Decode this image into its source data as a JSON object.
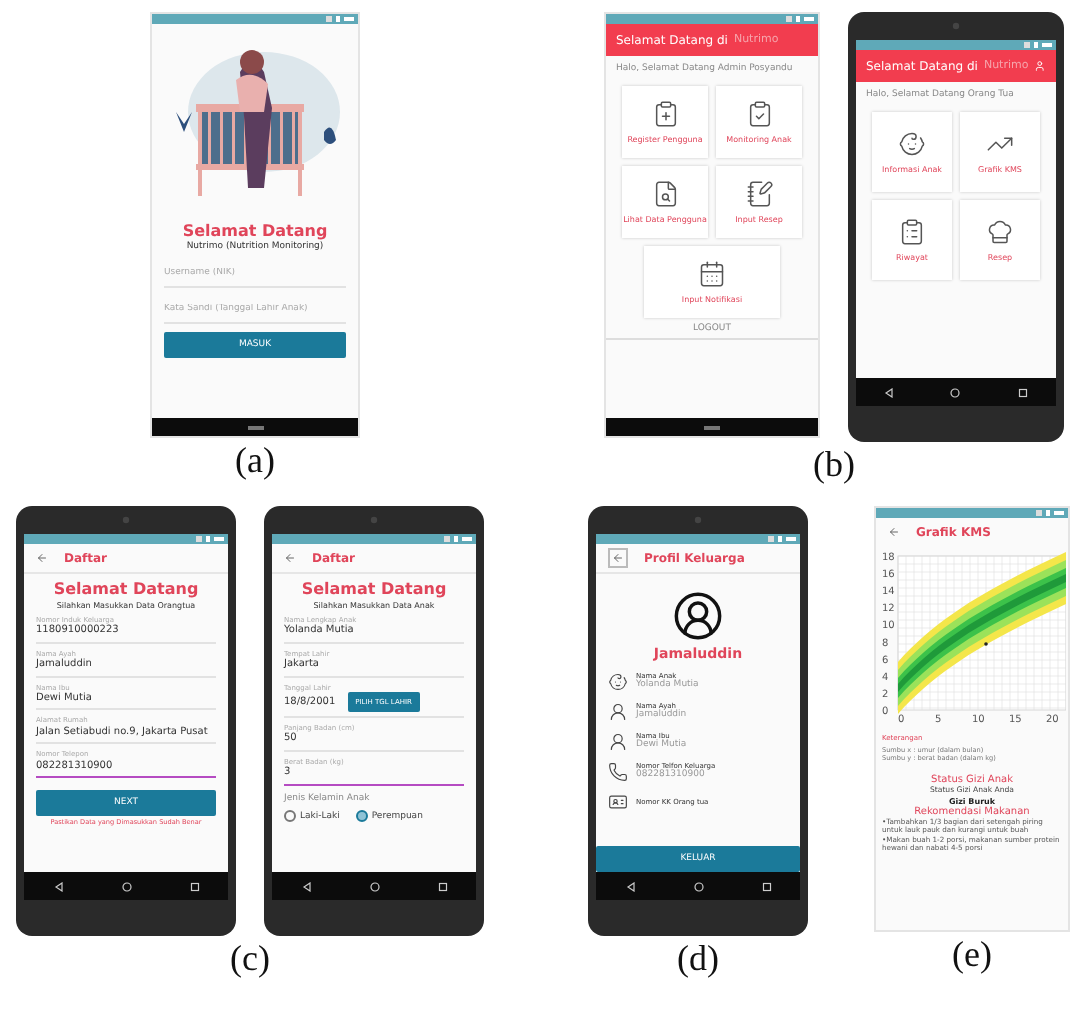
{
  "rows": [
    {
      "panels": [
        {
          "caption": "(a)",
          "screens": [
            {
              "kind": "login",
              "device": false,
              "nav_bar": true,
              "title": "Selamat Datang",
              "subtitle": "Nutrimo (Nutrition Monitoring)",
              "fields": [
                {
                  "placeholder": "Username (NIK)"
                },
                {
                  "placeholder": "Kata Sandi (Tanggal Lahir Anak)"
                }
              ],
              "button": "MASUK"
            }
          ]
        },
        {
          "caption": "(b)",
          "screens": [
            {
              "kind": "menu",
              "device": false,
              "nav_bar": true,
              "header": "Selamat Datang di",
              "brand": "Nutrimo",
              "account_button": false,
              "greeting": "Halo, Selamat Datang Admin Posyandu",
              "items": [
                "Register Pengguna",
                "Monitoring Anak",
                "Lihat Data Pengguna",
                "Input Resep",
                "Input Notifikasi"
              ],
              "footer": "LOGOUT"
            },
            {
              "kind": "menu",
              "device": true,
              "header": "Selamat Datang di",
              "brand": "Nutrimo",
              "account_button": true,
              "greeting": "Halo, Selamat Datang Orang Tua",
              "items": [
                "Informasi Anak",
                "Grafik KMS",
                "Riwayat",
                "Resep"
              ]
            }
          ]
        }
      ]
    },
    {
      "panels": [
        {
          "caption": "(c)",
          "screens": [
            {
              "kind": "form",
              "device": true,
              "header": "Daftar",
              "title": "Selamat Datang",
              "subtitle": "Silahkan Masukkan Data Orangtua",
              "fields": [
                {
                  "kind": "text",
                  "label": "Nomor Induk Keluarga",
                  "value": "1180910000223",
                  "focused": false
                },
                {
                  "kind": "text",
                  "label": "Nama Ayah",
                  "value": "Jamaluddin",
                  "focused": false
                },
                {
                  "kind": "text",
                  "label": "Nama Ibu",
                  "value": "Dewi Mutia",
                  "focused": false
                },
                {
                  "kind": "text",
                  "label": "Alamat Rumah",
                  "value": "Jalan Setiabudi no.9, Jakarta Pusat",
                  "focused": false
                },
                {
                  "kind": "text",
                  "label": "Nomor Telepon",
                  "value": "082281310900",
                  "focused": true
                }
              ],
              "button": "NEXT",
              "note": "Pastikan Data yang Dimasukkan Sudah Benar"
            },
            {
              "kind": "form",
              "device": true,
              "header": "Daftar",
              "title": "Selamat Datang",
              "subtitle": "Silahkan Masukkan Data Anak",
              "fields": [
                {
                  "kind": "text",
                  "label": "Nama Lengkap Anak",
                  "value": "Yolanda Mutia",
                  "focused": false
                },
                {
                  "kind": "text",
                  "label": "Tempat Lahir",
                  "value": "Jakarta",
                  "focused": false
                },
                {
                  "kind": "date",
                  "label": "Tanggal Lahir",
                  "value": "18/8/2001",
                  "button": "PILIH TGL LAHIR",
                  "focused": false
                },
                {
                  "kind": "text",
                  "label": "Panjang Badan (cm)",
                  "value": "50",
                  "focused": false
                },
                {
                  "kind": "text",
                  "label": "Berat Badan (kg)",
                  "value": "3",
                  "focused": true
                }
              ],
              "gender": {
                "label": "Jenis Kelamin Anak",
                "options": [
                  {
                    "label": "Laki-Laki",
                    "selected": false
                  },
                  {
                    "label": "Perempuan",
                    "selected": true
                  }
                ]
              }
            }
          ]
        },
        {
          "caption": "(d)",
          "screens": [
            {
              "kind": "profile",
              "device": true,
              "header": "Profil Keluarga",
              "name": "Jamaluddin",
              "rows": [
                {
                  "label": "Nama Anak",
                  "value": "Yolanda Mutia"
                },
                {
                  "label": "Nama Ayah",
                  "value": "Jamaluddin"
                },
                {
                  "label": "Nama Ibu",
                  "value": "Dewi Mutia"
                },
                {
                  "label": "Nomor Telfon Keluarga",
                  "value": "082281310900"
                },
                {
                  "label": "Nomor KK Orang tua"
                }
              ],
              "button": "KELUAR"
            }
          ]
        },
        {
          "caption": "(e)",
          "screens": [
            {
              "kind": "chart",
              "device": false,
              "nav_bar": false,
              "header": "Grafik KMS",
              "y_ticks": [
                "18",
                "16",
                "14",
                "12",
                "10",
                "8",
                "6",
                "4",
                "2",
                "0"
              ],
              "x_ticks": [
                "0",
                "5",
                "10",
                "15",
                "20"
              ],
              "legend_title": "Keterangan",
              "legend": [
                "Sumbu x : umur (dalam bulan)",
                "Sumbu y : berat badan (dalam kg)"
              ],
              "status_title": "Status Gizi Anak",
              "status_label": "Status Gizi Anak Anda",
              "status_value": "Gizi Buruk",
              "rec_title": "Rekomendasi Makanan",
              "recommendations": [
                "•Tambahkan 1/3 bagian dari setengah piring untuk lauk pauk dan kurangi untuk buah",
                "•Makan buah 1-2 porsi, makanan sumber protein hewani dan nabati 4-5 porsi"
              ]
            }
          ]
        }
      ]
    }
  ]
}
